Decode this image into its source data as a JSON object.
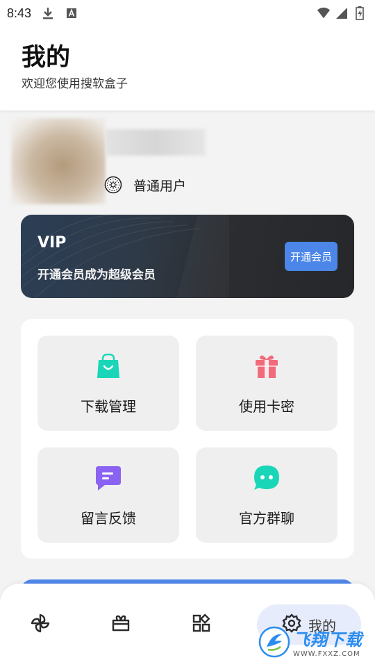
{
  "status_bar": {
    "time": "8:43",
    "icons": [
      "download-icon",
      "a-icon",
      "wifi-icon",
      "signal-icon",
      "battery-icon"
    ]
  },
  "header": {
    "title": "我的",
    "subtitle": "欢迎您使用搜软盒子"
  },
  "profile": {
    "role": "普通用户"
  },
  "vip": {
    "title": "VIP",
    "description": "开通会员成为超级会员",
    "button_label": "开通会员"
  },
  "features": [
    {
      "label": "下载管理",
      "icon": "shopping-bag-icon",
      "color": "#19d6b8"
    },
    {
      "label": "使用卡密",
      "icon": "gift-icon",
      "color": "#f26b7c"
    },
    {
      "label": "留言反馈",
      "icon": "message-icon",
      "color": "#8a63f2"
    },
    {
      "label": "官方群聊",
      "icon": "chat-bubble-icon",
      "color": "#19d6b8"
    }
  ],
  "nav": {
    "items": [
      {
        "icon": "pinwheel-icon"
      },
      {
        "icon": "ticket-icon"
      },
      {
        "icon": "apps-grid-icon"
      },
      {
        "icon": "gear-icon",
        "label": "我的",
        "active": true
      }
    ]
  },
  "watermark": {
    "text": "飞翔下载",
    "url": "WWW.FXXZ.COM"
  },
  "colors": {
    "accent": "#4b86e8",
    "teal": "#19d6b8",
    "pink": "#f26b7c",
    "purple": "#8a63f2"
  }
}
